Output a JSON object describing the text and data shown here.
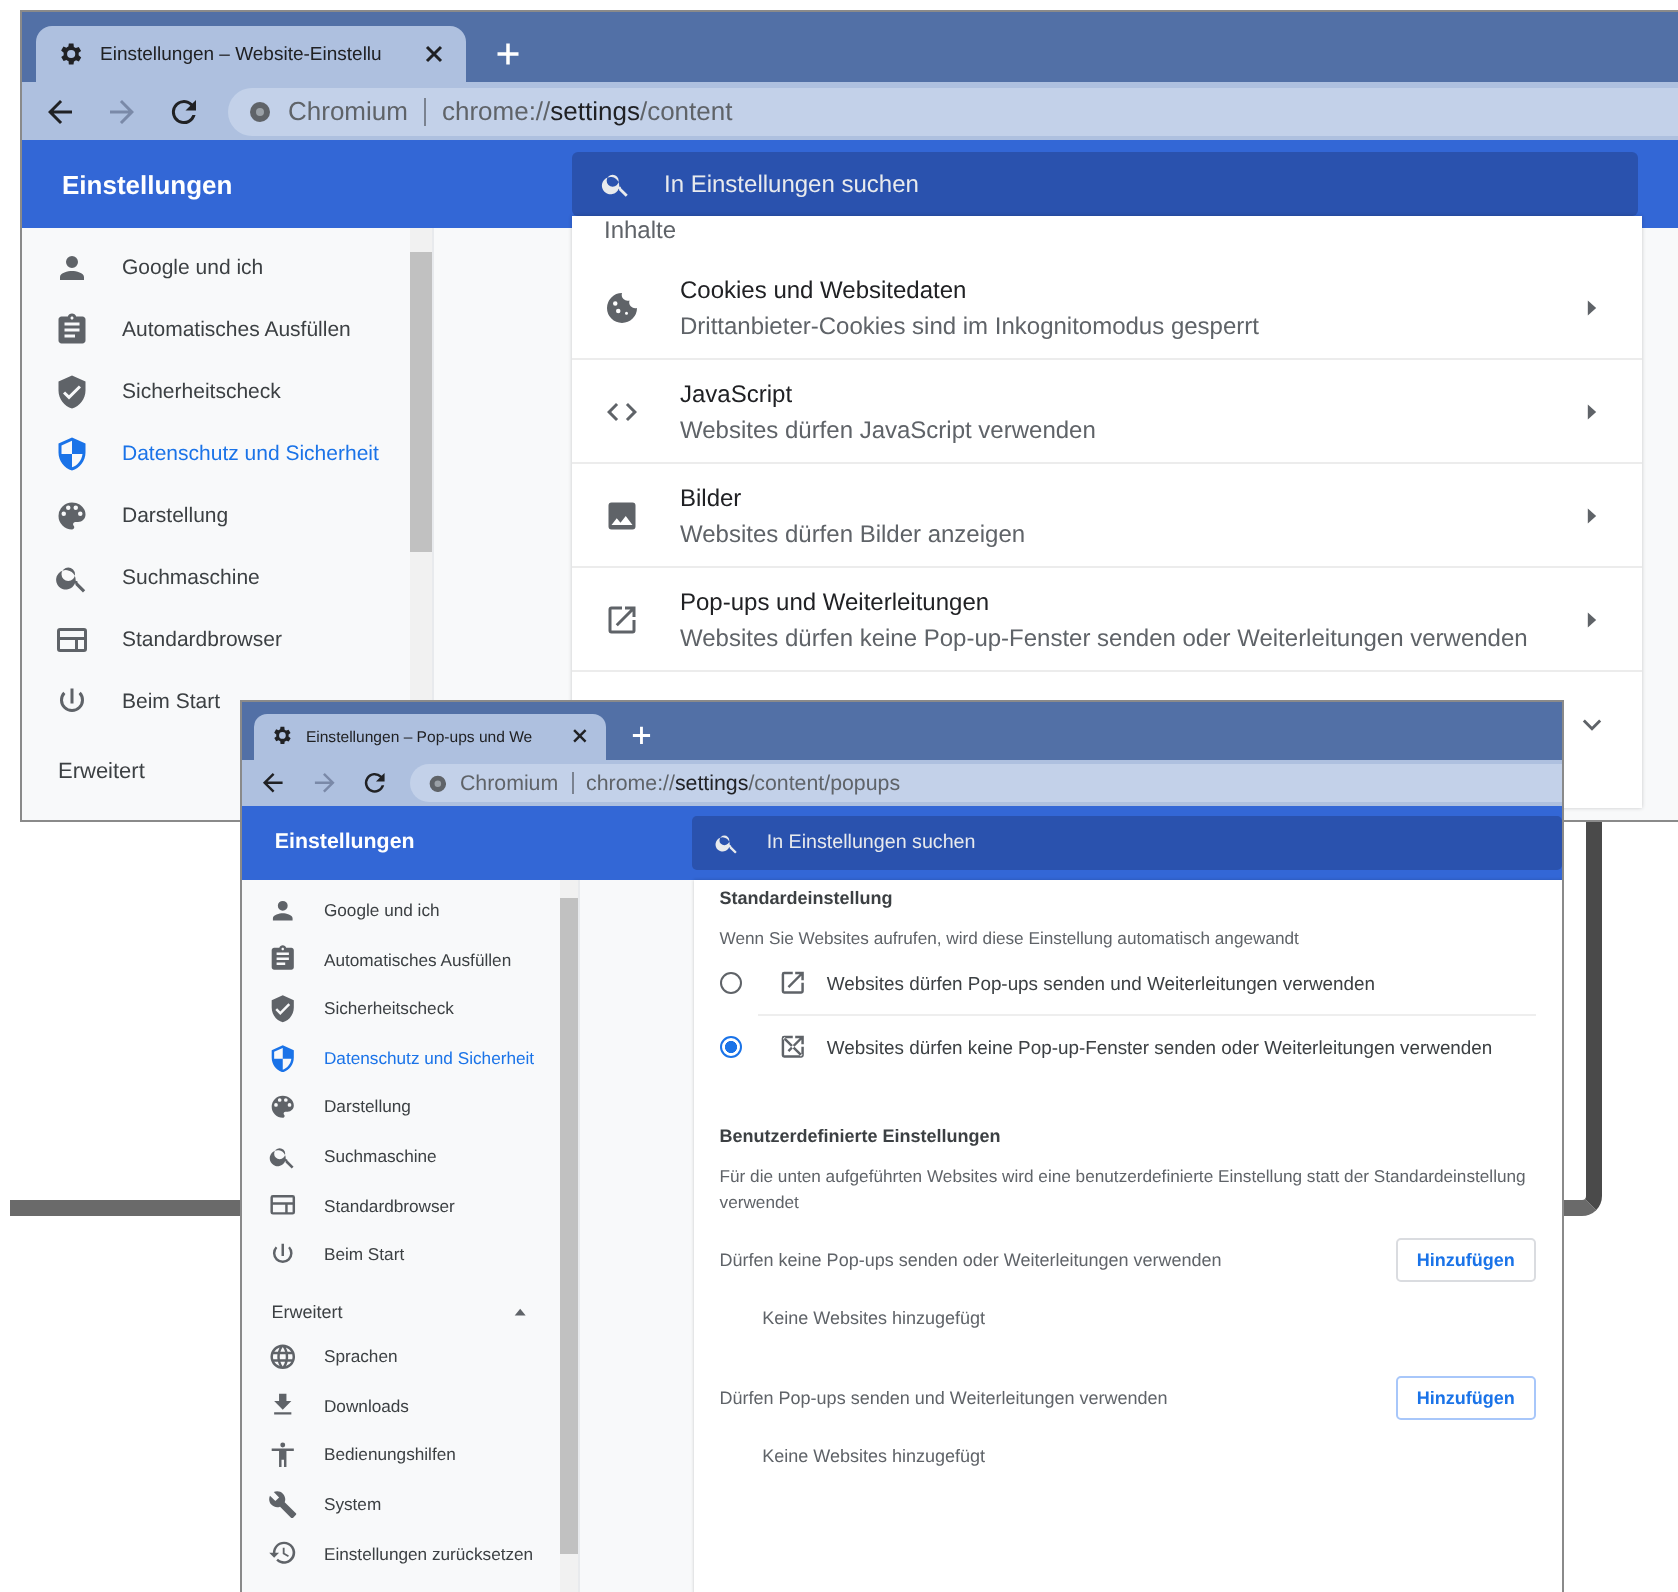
{
  "windows": [
    {
      "kind": "content",
      "tab": {
        "title": "Einstellungen – Website-Einstellu"
      },
      "omnibox": {
        "site": "Chromium",
        "url": "chrome://**settings**/content"
      },
      "header": {
        "title": "Einstellungen",
        "search_placeholder": "In Einstellungen suchen"
      },
      "sidebar": {
        "items": [
          {
            "label": "Google und ich",
            "selected": false
          },
          {
            "label": "Automatisches Ausfüllen",
            "selected": false
          },
          {
            "label": "Sicherheitscheck",
            "selected": false
          },
          {
            "label": "Datenschutz und Sicherheit",
            "selected": true
          },
          {
            "label": "Darstellung",
            "selected": false
          },
          {
            "label": "Suchmaschine",
            "selected": false
          },
          {
            "label": "Standardbrowser",
            "selected": false
          },
          {
            "label": "Beim Start",
            "selected": false
          }
        ],
        "advanced": {
          "label": "Erweitert"
        }
      },
      "content": {
        "section": "Inhalte",
        "rows": [
          {
            "title": "Cookies und Websitedaten",
            "subtitle": "Drittanbieter-Cookies sind im Inkognitomodus gesperrt"
          },
          {
            "title": "JavaScript",
            "subtitle": "Websites dürfen JavaScript verwenden"
          },
          {
            "title": "Bilder",
            "subtitle": "Websites dürfen Bilder anzeigen"
          },
          {
            "title": "Pop-ups und Weiterleitungen",
            "subtitle": "Websites dürfen keine Pop-up-Fenster senden oder Weiterleitungen verwenden"
          }
        ],
        "more": {
          "expanded": false
        }
      }
    },
    {
      "kind": "popups",
      "tab": {
        "title": "Einstellungen – Pop-ups und We"
      },
      "omnibox": {
        "site": "Chromium",
        "url": "chrome://**settings**/content/popups"
      },
      "header": {
        "title": "Einstellungen",
        "search_placeholder": "In Einstellungen suchen"
      },
      "sidebar": {
        "items": [
          {
            "label": "Google und ich",
            "selected": false
          },
          {
            "label": "Automatisches Ausfüllen",
            "selected": false
          },
          {
            "label": "Sicherheitscheck",
            "selected": false
          },
          {
            "label": "Datenschutz und Sicherheit",
            "selected": true
          },
          {
            "label": "Darstellung",
            "selected": false
          },
          {
            "label": "Suchmaschine",
            "selected": false
          },
          {
            "label": "Standardbrowser",
            "selected": false
          },
          {
            "label": "Beim Start",
            "selected": false
          }
        ],
        "advanced": {
          "label": "Erweitert",
          "expanded": true,
          "items": [
            {
              "label": "Sprachen",
              "selected": false
            },
            {
              "label": "Downloads",
              "selected": false
            },
            {
              "label": "Bedienungshilfen",
              "selected": false
            },
            {
              "label": "System",
              "selected": false
            },
            {
              "label": "Einstellungen zurücksetzen",
              "selected": false
            }
          ]
        }
      },
      "content": {
        "default": {
          "heading": "Standardeinstellung",
          "description": "Wenn Sie Websites aufrufen, wird diese Einstellung automatisch angewandt",
          "options": [
            {
              "label": "Websites dürfen Pop-ups senden und Weiterleitungen verwenden",
              "selected": false
            },
            {
              "label": "Websites dürfen keine Pop-up-Fenster senden oder Weiterleitungen verwenden",
              "selected": true
            }
          ]
        },
        "custom": {
          "heading": "Benutzerdefinierte Einstellungen",
          "description": "Für die unten aufgeführten Websites wird eine benutzerdefinierte Einstellung statt der Standardeinstellung verwendet",
          "groups": [
            {
              "label": "Dürfen keine Pop-ups senden oder Weiterleitungen verwenden",
              "button": "Hinzufügen",
              "empty": "Keine Websites hinzugefügt",
              "focused": false
            },
            {
              "label": "Dürfen Pop-ups senden und Weiterleitungen verwenden",
              "button": "Hinzufügen",
              "empty": "Keine Websites hinzugefügt",
              "focused": true
            }
          ]
        }
      }
    }
  ]
}
